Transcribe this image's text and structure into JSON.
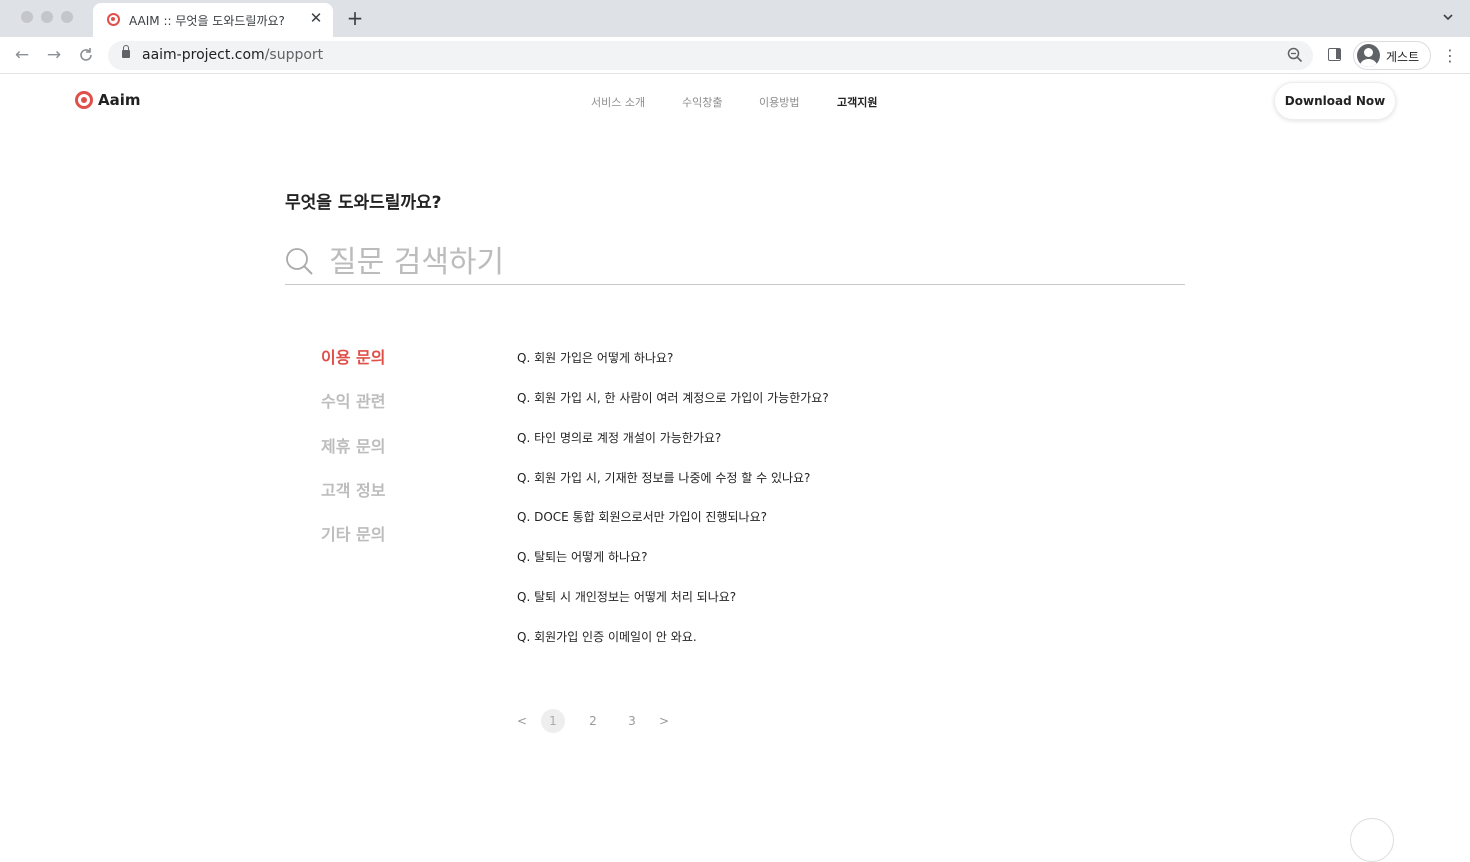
{
  "browser": {
    "tab_title": "AAIM :: 무엇을 도와드릴까요?",
    "url_host": "aaim-project.com",
    "url_path": "/support",
    "profile_label": "게스트"
  },
  "header": {
    "logo_text": "Aaim",
    "nav": [
      "서비스 소개",
      "수익창출",
      "이용방법",
      "고객지원"
    ],
    "active_nav": "고객지원",
    "download_label": "Download Now"
  },
  "main": {
    "title": "무엇을 도와드릴까요?",
    "search_placeholder": "질문 검색하기",
    "categories": [
      "이용 문의",
      "수익 관련",
      "제휴 문의",
      "고객 정보",
      "기타 문의"
    ],
    "active_category": "이용 문의",
    "faqs": [
      "Q. 회원 가입은 어떻게 하나요?",
      "Q. 회원 가입 시, 한 사람이 여러 계정으로 가입이 가능한가요?",
      "Q. 타인 명의로 계정 개설이 가능한가요?",
      "Q. 회원 가입 시, 기재한 정보를 나중에 수정 할 수 있나요?",
      "Q. DOCE 통합 회원으로서만 가입이 진행되나요?",
      "Q. 탈퇴는 어떻게 하나요?",
      "Q. 탈퇴 시 개인정보는 어떻게 처리 되나요?",
      "Q. 회원가입 인증 이메일이 안 와요."
    ],
    "pagination": {
      "prev": "<",
      "pages": [
        "1",
        "2",
        "3"
      ],
      "current": "1",
      "next": ">"
    }
  },
  "colors": {
    "accent": "#e0504a",
    "text": "#222222",
    "muted": "#bdbdbd"
  }
}
